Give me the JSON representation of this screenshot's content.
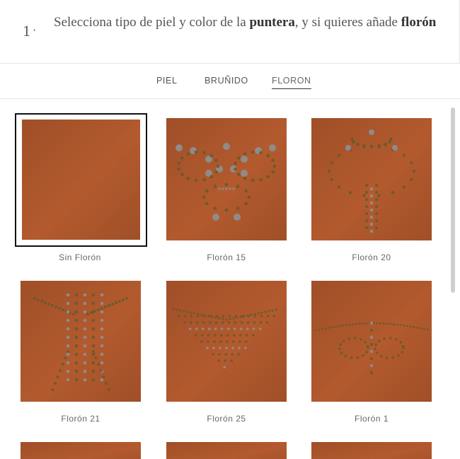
{
  "step": {
    "number": "1",
    "separator": "·",
    "text_part1": "Selecciona tipo de piel y color de la ",
    "text_bold1": "puntera",
    "text_part2": ", y si quieres añade ",
    "text_bold2": "florón"
  },
  "tabs": [
    {
      "label": "PIEL",
      "active": false
    },
    {
      "label": "BRUÑIDO",
      "active": false
    },
    {
      "label": "FLORON",
      "active": true
    }
  ],
  "options": [
    {
      "label": "Sin Florón",
      "pattern": "none",
      "selected": true
    },
    {
      "label": "Florón 15",
      "pattern": "floron-15",
      "selected": false
    },
    {
      "label": "Florón 20",
      "pattern": "floron-20",
      "selected": false
    },
    {
      "label": "Florón 21",
      "pattern": "floron-21",
      "selected": false
    },
    {
      "label": "Florón 25",
      "pattern": "floron-25",
      "selected": false
    },
    {
      "label": "Florón 1",
      "pattern": "floron-1",
      "selected": false
    },
    {
      "label": "",
      "pattern": "partial",
      "selected": false
    },
    {
      "label": "",
      "pattern": "partial",
      "selected": false
    },
    {
      "label": "",
      "pattern": "partial",
      "selected": false
    }
  ],
  "colors": {
    "leather": "#b35a2e",
    "leather_dark": "#a04f28",
    "hole": "#8e8e8e",
    "stud": "#6b5a2a",
    "selected_border": "#111111"
  }
}
